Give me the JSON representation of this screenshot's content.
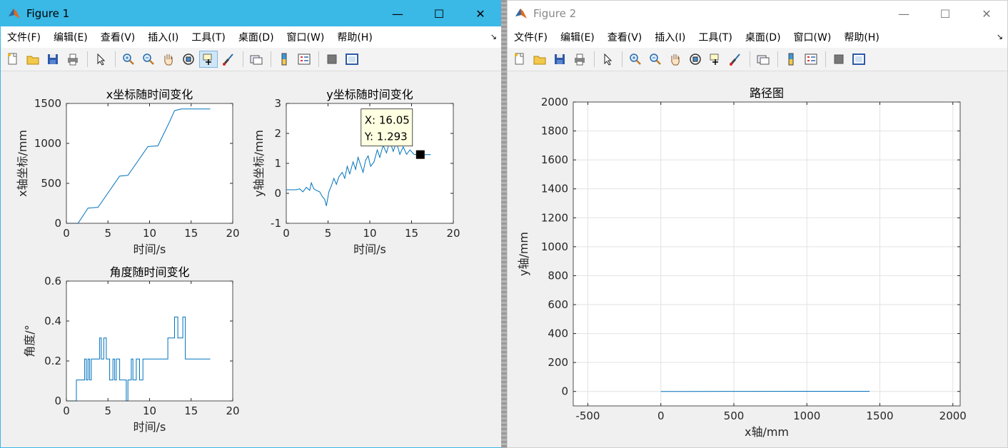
{
  "colors": {
    "line": "#0072bd",
    "titlebar_active": "#3ab8e6"
  },
  "windows": [
    {
      "title": "Figure 1",
      "menus": [
        "文件(F)",
        "编辑(E)",
        "查看(V)",
        "插入(I)",
        "工具(T)",
        "桌面(D)",
        "窗口(W)",
        "帮助(H)"
      ],
      "controls": {
        "minimize": "—",
        "maximize": "☐",
        "close": "✕"
      }
    },
    {
      "title": "Figure 2",
      "menus": [
        "文件(F)",
        "编辑(E)",
        "查看(V)",
        "插入(I)",
        "工具(T)",
        "桌面(D)",
        "窗口(W)",
        "帮助(H)"
      ],
      "controls": {
        "minimize": "—",
        "maximize": "☐",
        "close": "✕"
      }
    }
  ],
  "toolbar_icons": [
    "new-figure-icon",
    "open-file-icon",
    "save-icon",
    "print-icon",
    "|",
    "select-arrow-icon",
    "|",
    "zoom-in-icon",
    "zoom-out-icon",
    "pan-hand-icon",
    "rotate-3d-icon",
    "data-cursor-icon",
    "brush-icon",
    "|",
    "link-plot-icon",
    "|",
    "colorbar-icon",
    "legend-icon",
    "|",
    "hide-plot-tools-icon",
    "show-plot-tools-icon"
  ],
  "chart_data": [
    {
      "type": "line",
      "title": "x坐标随时间变化",
      "xlabel": "时间/s",
      "ylabel": "x轴坐标/mm",
      "xlim": [
        0,
        20
      ],
      "ylim": [
        0,
        1500
      ],
      "xticks": [
        "0",
        "5",
        "10",
        "15",
        "20"
      ],
      "yticks": [
        "0",
        "500",
        "1000",
        "1500"
      ],
      "grid": false,
      "x": [
        0,
        1.4,
        2.6,
        3.8,
        4.4,
        6.4,
        7.4,
        8.6,
        9.8,
        11.0,
        12.4,
        13.0,
        13.8,
        17.3
      ],
      "y": [
        0,
        0,
        190,
        200,
        290,
        590,
        600,
        780,
        960,
        970,
        1270,
        1410,
        1430,
        1430
      ]
    },
    {
      "type": "line",
      "title": "y坐标随时间变化",
      "xlabel": "时间/s",
      "ylabel": "y轴坐标/mm",
      "xlim": [
        0,
        20
      ],
      "ylim": [
        -1,
        3
      ],
      "xticks": [
        "0",
        "5",
        "10",
        "15",
        "20"
      ],
      "yticks": [
        "-1",
        "0",
        "1",
        "2",
        "3"
      ],
      "grid": false,
      "x": [
        0,
        1.2,
        1.6,
        2.0,
        2.4,
        2.8,
        3.0,
        3.3,
        3.6,
        4.0,
        4.3,
        4.6,
        4.8,
        5.1,
        5.4,
        5.7,
        6.0,
        6.3,
        6.7,
        7.0,
        7.3,
        7.6,
        8.0,
        8.3,
        8.6,
        8.9,
        9.2,
        9.5,
        9.8,
        10.1,
        10.5,
        10.9,
        11.2,
        11.6,
        12.0,
        12.4,
        12.8,
        13.2,
        13.6,
        14.0,
        14.4,
        14.8,
        15.3,
        16.05,
        17.3
      ],
      "y": [
        0.12,
        0.12,
        0.15,
        0.05,
        0.2,
        0.1,
        0.35,
        0.15,
        0.1,
        0.05,
        -0.1,
        -0.2,
        -0.42,
        0.05,
        0.25,
        0.5,
        0.3,
        0.55,
        0.7,
        0.5,
        0.9,
        0.65,
        1.05,
        0.8,
        1.2,
        0.95,
        0.7,
        1.1,
        1.25,
        0.9,
        1.05,
        1.45,
        1.2,
        1.6,
        1.35,
        1.75,
        1.4,
        1.7,
        1.3,
        1.55,
        1.3,
        1.45,
        1.3,
        1.293,
        1.293
      ]
    },
    {
      "type": "line",
      "title": "角度随时间变化",
      "xlabel": "时间/s",
      "ylabel": "角度/°",
      "xlim": [
        0,
        20
      ],
      "ylim": [
        0,
        0.6
      ],
      "xticks": [
        "0",
        "5",
        "10",
        "15",
        "20"
      ],
      "yticks": [
        "0",
        "0.2",
        "0.4",
        "0.6"
      ],
      "grid": false,
      "x": [
        0,
        1.2,
        1.2,
        2.2,
        2.2,
        2.4,
        2.4,
        2.6,
        2.6,
        2.8,
        2.8,
        3.0,
        3.0,
        3.2,
        3.2,
        4.0,
        4.0,
        4.2,
        4.2,
        4.5,
        4.5,
        4.8,
        4.8,
        5.2,
        5.2,
        5.6,
        5.6,
        5.8,
        5.8,
        6.0,
        6.0,
        6.4,
        6.4,
        7.2,
        7.2,
        7.4,
        7.4,
        7.8,
        7.8,
        8.0,
        8.0,
        8.4,
        8.4,
        8.8,
        8.8,
        9.2,
        9.2,
        9.5,
        9.5,
        10.5,
        10.5,
        10.8,
        10.8,
        11.4,
        11.4,
        12.2,
        12.2,
        13.0,
        13.0,
        13.4,
        13.4,
        14.0,
        14.0,
        14.3,
        14.3,
        14.5,
        14.5,
        17.3
      ],
      "y": [
        0,
        0,
        0.105,
        0.105,
        0.21,
        0.21,
        0.105,
        0.105,
        0.21,
        0.21,
        0.105,
        0.105,
        0.21,
        0.21,
        0.21,
        0.21,
        0.315,
        0.315,
        0.21,
        0.21,
        0.315,
        0.315,
        0.21,
        0.21,
        0.105,
        0.105,
        0.21,
        0.21,
        0.105,
        0.105,
        0.21,
        0.21,
        0.105,
        0.105,
        0,
        0,
        0.105,
        0.105,
        0.21,
        0.21,
        0.105,
        0.105,
        0.21,
        0.21,
        0.105,
        0.105,
        0.21,
        0.21,
        0.21,
        0.21,
        0.21,
        0.21,
        0.21,
        0.21,
        0.21,
        0.21,
        0.315,
        0.315,
        0.42,
        0.42,
        0.315,
        0.315,
        0.42,
        0.42,
        0.21,
        0.21,
        0.21,
        0.21
      ]
    },
    {
      "type": "line",
      "title": "路径图",
      "xlabel": "x轴/mm",
      "ylabel": "y轴/mm",
      "xlim": [
        -600,
        2050
      ],
      "ylim": [
        -100,
        2000
      ],
      "xticks": [
        "-500",
        "0",
        "500",
        "1000",
        "1500",
        "2000"
      ],
      "yticks": [
        "0",
        "200",
        "400",
        "600",
        "800",
        "1000",
        "1200",
        "1400",
        "1600",
        "1800",
        "2000"
      ],
      "grid": true,
      "x": [
        0,
        200,
        600,
        1000,
        1430
      ],
      "y": [
        0,
        0.2,
        0.6,
        1.2,
        1.3
      ]
    }
  ],
  "datatip": {
    "x_label": "X: 16.05",
    "y_label": "Y: 1.293",
    "x": 16.05,
    "y": 1.293
  }
}
